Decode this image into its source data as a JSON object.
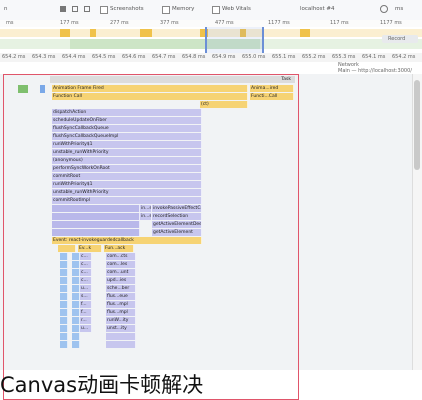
{
  "toolbar": {
    "label_1": "n",
    "screenshots_label": "Screenshots",
    "memory_label": "Memory",
    "web_vitals_label": "Web Vitals",
    "target_label": "localhost #4",
    "small_label": "ms"
  },
  "overview": {
    "ticks": [
      "ms",
      "177 ms",
      "277 ms",
      "377 ms",
      "477 ms",
      "1177 ms",
      "117 ms",
      "1177 ms"
    ],
    "record_label": "Record"
  },
  "ruler2": {
    "ticks": [
      "654.2 ms",
      "654.3 ms",
      "654.4 ms",
      "654.5 ms",
      "654.6 ms",
      "654.7 ms",
      "654.8 ms",
      "654.9 ms",
      "655.0 ms",
      "655.1 ms",
      "655.2 ms",
      "655.3 ms",
      "654.1 ms",
      "654.2 ms"
    ]
  },
  "subheader": {
    "network_label": "Network",
    "main_label": "Main — http://localhost:3000/"
  },
  "flame": {
    "task_label": "Task",
    "rows": [
      {
        "label": "Anima...ired",
        "label2": "Animation Frame Fired"
      },
      {
        "label": "Functi...Call",
        "label2": "Function Call"
      },
      {
        "label": "(ct)"
      },
      {
        "label": "dispatchAction"
      },
      {
        "label": "scheduleUpdateOnFiber"
      },
      {
        "label": "flushSyncCallbackQueue"
      },
      {
        "label": "flushSyncCallbackQueueImpl"
      },
      {
        "label": "runWithPriority$1"
      },
      {
        "label": "unstable_runWithPriority"
      },
      {
        "label": "(anonymous)"
      },
      {
        "label": "performSyncWorkOnRoot"
      },
      {
        "label": "commitRoot"
      },
      {
        "label": "runWithPriority$1"
      },
      {
        "label": "unstable_runWithPriority"
      },
      {
        "label": "commitRootImpl"
      },
      {
        "label": "in...s",
        "label2": "invokePassiveEffectCreate"
      },
      {
        "label": "in...s",
        "label2": "recordSelection"
      },
      {
        "label": "",
        "label2": "getActiveElementDeep"
      },
      {
        "label": "",
        "label2": "getActiveElement"
      },
      {
        "label": "Event: react-invokeguardedcallback"
      },
      {
        "label": "Ev...k",
        "label2": "Fun...ack"
      },
      {
        "label": "c...",
        "label2": "com...cts"
      },
      {
        "label": "c...",
        "label2": "com...les"
      },
      {
        "label": "c...",
        "label2": "com...unt"
      },
      {
        "label": "c...",
        "label2": "upd...ies"
      },
      {
        "label": "u...",
        "label2": "sche...ber"
      },
      {
        "label": "s...",
        "label2": "flus...eue"
      },
      {
        "label": "f...",
        "label2": "flus...mpl"
      },
      {
        "label": "f...",
        "label2": "flus...mpl"
      },
      {
        "label": "r...",
        "label2": "runW...ity"
      },
      {
        "label": "u...",
        "label2": "unst...ity"
      }
    ]
  },
  "caption": {
    "text": "Canvas动画卡顿解决"
  }
}
